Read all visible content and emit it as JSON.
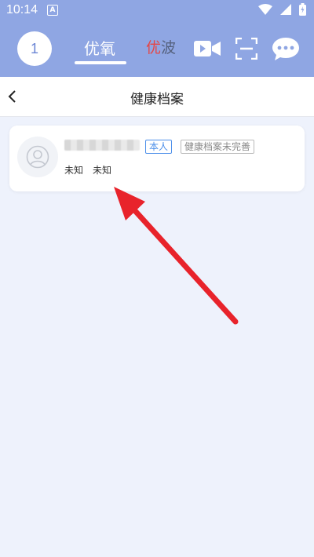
{
  "status_bar": {
    "time": "10:14",
    "a_badge": "A"
  },
  "app_bar": {
    "avatar_text": "1",
    "tab_active": "优氧",
    "tab_inactive_first": "优",
    "tab_inactive_second": "波",
    "icons": [
      "video-icon",
      "scan-icon",
      "chat-icon"
    ]
  },
  "title_bar": {
    "title": "健康档案"
  },
  "profile_card": {
    "badge_self": "本人",
    "badge_status": "健康档案未完善",
    "gender": "未知",
    "age": "未知"
  },
  "colors": {
    "header_bg": "#8FA6E3",
    "page_bg": "#EEF2FC",
    "badge_blue": "#4C8FEA",
    "arrow_red": "#E8232B"
  }
}
